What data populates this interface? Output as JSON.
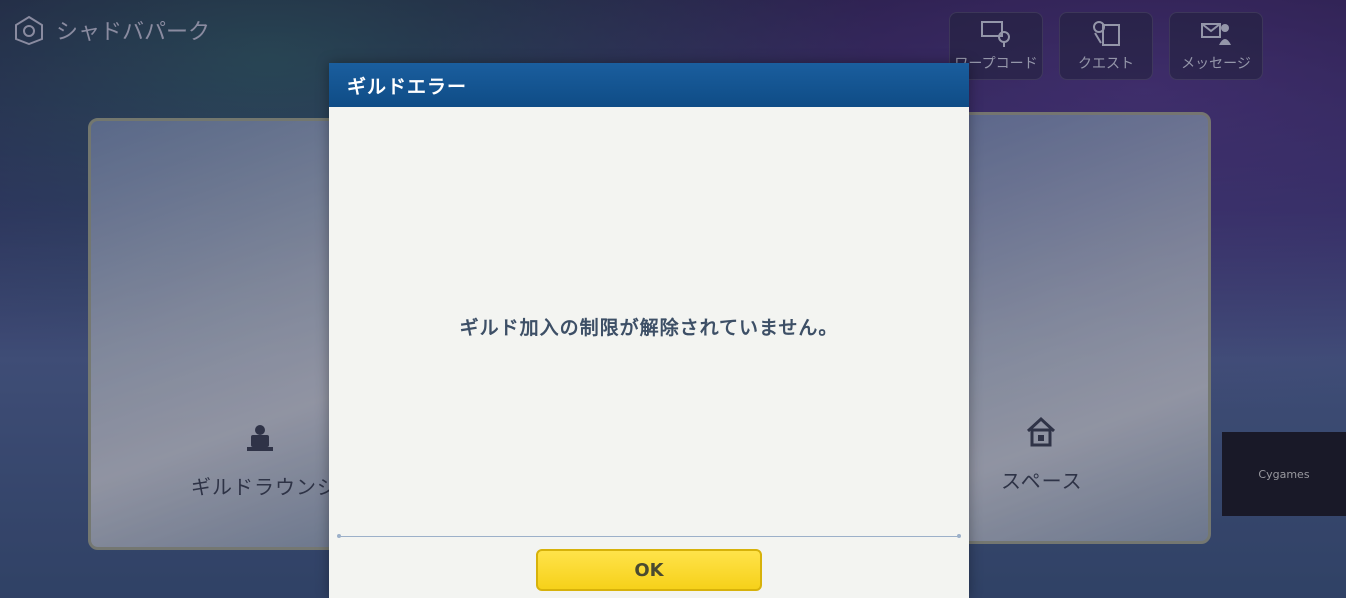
{
  "header": {
    "title": "シャドバパーク",
    "buttons": [
      {
        "label": "ワープコード",
        "icon": "warp-code-icon"
      },
      {
        "label": "クエスト",
        "icon": "quest-icon"
      },
      {
        "label": "メッセージ",
        "icon": "message-icon"
      }
    ]
  },
  "background": {
    "left_card": {
      "label": "ギルドラウンジ",
      "icon": "guild-lounge-icon"
    },
    "right_card": {
      "label": "スペース",
      "icon": "home-icon"
    },
    "side_panel_text": "Cygames"
  },
  "dialog": {
    "title": "ギルドエラー",
    "message": "ギルド加入の制限が解除されていません。",
    "ok_label": "OK"
  },
  "colors": {
    "header_blue": "#0f4c86",
    "ok_yellow": "#f6d11a",
    "message_text": "#3d4f66"
  }
}
